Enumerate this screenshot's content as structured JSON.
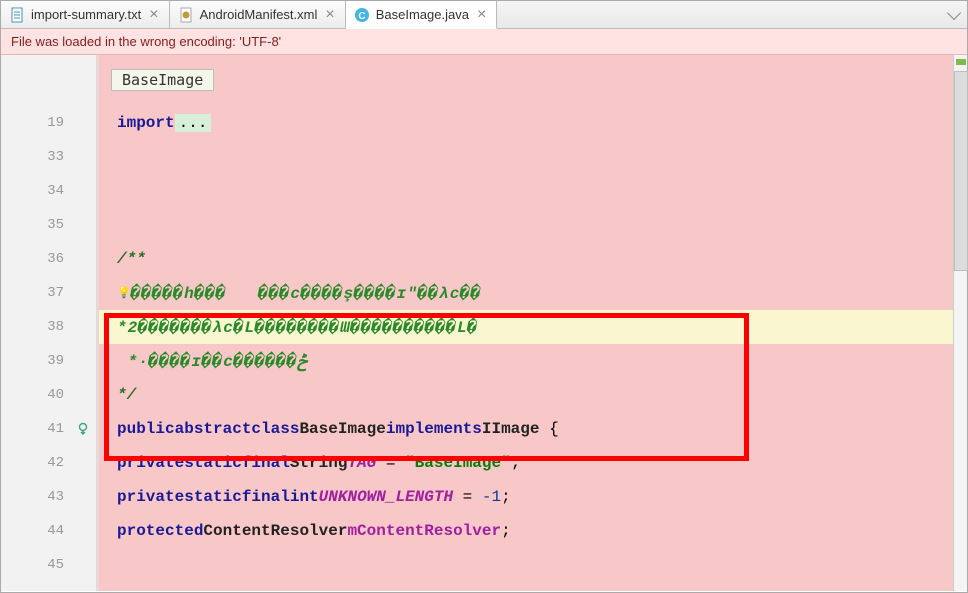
{
  "tabs": [
    {
      "label": "import-summary.txt",
      "icon": "text-file-icon",
      "active": false
    },
    {
      "label": "AndroidManifest.xml",
      "icon": "xml-file-icon",
      "active": false
    },
    {
      "label": "BaseImage.java",
      "icon": "java-file-icon",
      "active": true
    }
  ],
  "warning": "File was loaded in the wrong encoding: 'UTF-8'",
  "breadcrumb": "BaseImage",
  "gutter": {
    "line_numbers": [
      "19",
      "33",
      "34",
      "35",
      "36",
      "37",
      "38",
      "39",
      "40",
      "41",
      "42",
      "43",
      "44",
      "45"
    ]
  },
  "code": {
    "import_kw": "import",
    "import_rest": "...",
    "comment_open": "/**",
    "garbled_37": "�����h���   ���c����ş����ɪ\"��λc��",
    "garbled_38": "*2�������λc�L��������Ɯ����������L�",
    "garbled_39": " *·����ɪ��c������ݲ",
    "comment_close": "*/",
    "decl_public": "public",
    "decl_abstract": "abstract",
    "decl_class": "class",
    "decl_name": "BaseImage",
    "decl_implements": "implements",
    "decl_iface": "IImage",
    "l42_private": "private",
    "l42_static": "static",
    "l42_final": "final",
    "l42_type": "String",
    "l42_field": "TAG",
    "l42_eq": " = ",
    "l42_val": "\"BaseImage\"",
    "l43_private": "private",
    "l43_static": "static",
    "l43_final": "final",
    "l43_type": "int",
    "l43_field": "UNKNOWN_LENGTH",
    "l43_eq": " = ",
    "l43_val": "-1",
    "l44_protected": "protected",
    "l44_type": "ContentResolver",
    "l44_field": "mContentResolver"
  },
  "icons": {
    "bulb": "💡",
    "pin": "📌"
  }
}
